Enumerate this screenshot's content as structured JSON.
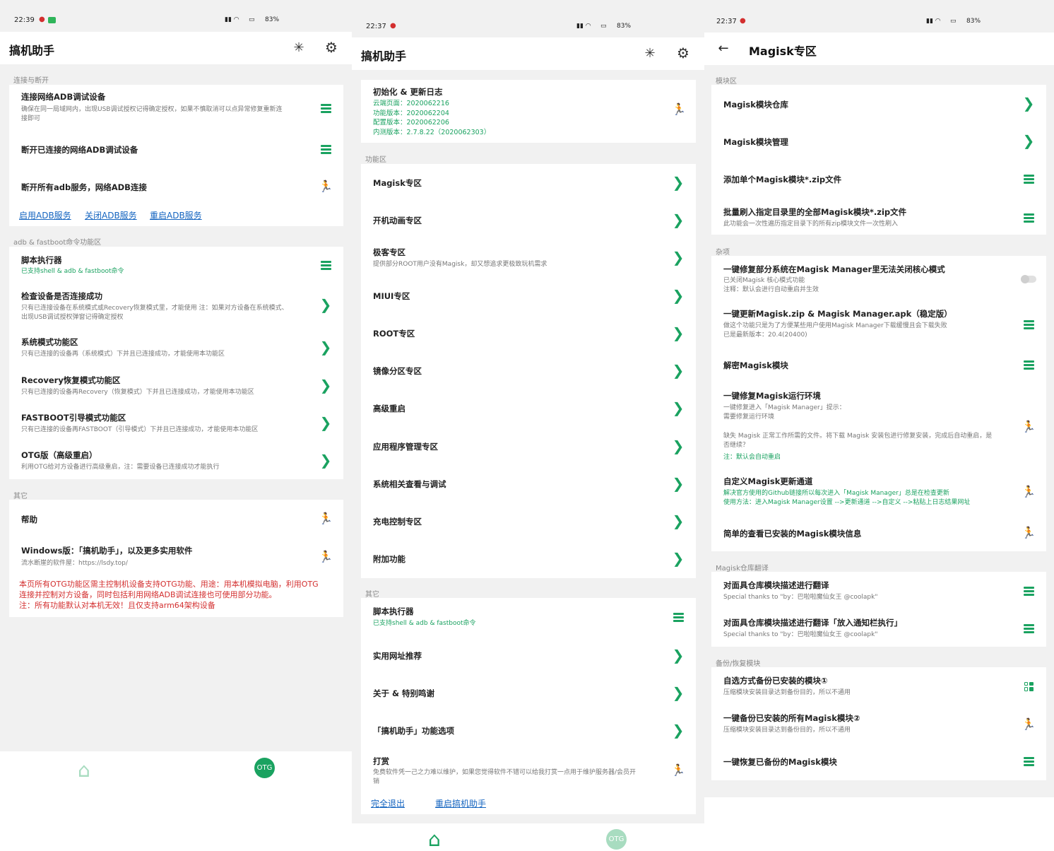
{
  "colors": {
    "accent": "#1aa260",
    "link": "#1565c0",
    "warning": "#d32f2f",
    "background": "#f1f1f1"
  },
  "screen1": {
    "status": {
      "time": "22:39",
      "battery": "83%"
    },
    "title": "搞机助手",
    "sections": [
      {
        "label": "连接与断开"
      },
      {
        "label": "adb & fastboot命令功能区"
      },
      {
        "label": "其它"
      }
    ],
    "items": [
      {
        "title": "连接网络ADB调试设备",
        "sub": "确保在同一局域网内，出现USB调试授权记得确定授权，如果不慎取消可以点异常修复重新连",
        "sub2": "接即可",
        "icon": "menu-icon"
      },
      {
        "title": "断开已连接的网络ADB调试设备",
        "icon": "menu-icon"
      },
      {
        "title": "断开所有adb服务，网络ADB连接",
        "icon": "run-icon"
      },
      {
        "title": "脚本执行器",
        "sub": "已支持shell & adb & fastboot命令",
        "icon": "menu-icon"
      },
      {
        "title": "检查设备是否连接成功",
        "sub": "只有已连接设备在系统模式或Recovery恢复模式里，才能使用 注：如果对方设备在系统模式、",
        "sub2": "出现USB调试授权弹窗记得确定授权",
        "icon": "chevron-right-icon"
      },
      {
        "title": "系统模式功能区",
        "sub": "只有已连接的设备再（系统模式）下并且已连接成功，才能使用本功能区",
        "icon": "chevron-right-icon"
      },
      {
        "title": "Recovery恢复模式功能区",
        "sub": "只有已连接的设备再Recovery（恢复模式）下并且已连接成功，才能使用本功能区",
        "icon": "chevron-right-icon"
      },
      {
        "title": "FASTBOOT引导模式功能区",
        "sub": "只有已连接的设备再FASTBOOT（引导模式）下并且已连接成功，才能使用本功能区",
        "icon": "chevron-right-icon"
      },
      {
        "title": "OTG版（高级重启）",
        "sub": "利用OTG给对方设备进行高级重启，注：需要设备已连接成功才能执行",
        "icon": "chevron-right-icon"
      },
      {
        "title": "帮助",
        "icon": "run-icon"
      },
      {
        "title": "Windows版：「搞机助手」，以及更多实用软件",
        "sub": "流水断崖的软件屋：https://lsdy.top/",
        "icon": "run-icon"
      }
    ],
    "links": [
      "启用ADB服务",
      "关闭ADB服务",
      "重启ADB服务"
    ],
    "warning": [
      "本页所有OTG功能区需主控制机设备支持OTG功能、用途：用本机模拟电脑，利用OTG",
      "连接并控制对方设备，同时包括利用网络ADB调试连接也可使用部分功能。",
      "注：所有功能默认对本机无效！且仅支持arm64架构设备"
    ],
    "otg": "OTG"
  },
  "screen2": {
    "status": {
      "time": "22:37",
      "battery": "83%"
    },
    "title": "搞机助手",
    "init": {
      "title": "初始化 & 更新日志",
      "lines": [
        "云端页面：2020062216",
        "功能版本：2020062204",
        "配置版本：2020062206",
        "内测版本：2.7.8.22（2020062303）"
      ]
    },
    "sections": [
      {
        "label": "功能区"
      },
      {
        "label": "其它"
      }
    ],
    "features": [
      {
        "title": "Magisk专区"
      },
      {
        "title": "开机动画专区"
      },
      {
        "title": "极客专区",
        "sub": "提供部分ROOT用户没有Magisk，却又想追求更极致玩机需求"
      },
      {
        "title": "MIUI专区"
      },
      {
        "title": "ROOT专区"
      },
      {
        "title": "镜像分区专区"
      },
      {
        "title": "高级重启"
      },
      {
        "title": "应用程序管理专区"
      },
      {
        "title": "系统相关查看与调试"
      },
      {
        "title": "充电控制专区"
      },
      {
        "title": "附加功能"
      }
    ],
    "others": [
      {
        "title": "脚本执行器",
        "sub": "已支持shell & adb & fastboot命令",
        "icon": "menu-icon"
      },
      {
        "title": "实用网址推荐",
        "icon": "chevron-right-icon"
      },
      {
        "title": "关于 & 特别鸣谢",
        "icon": "chevron-right-icon"
      },
      {
        "title": "「搞机助手」功能选项",
        "icon": "chevron-right-icon"
      },
      {
        "title": "打赏",
        "sub": "免费软件凭一己之力难以维护，如果您觉得软件不错可以给我打赏一点用于维护服务器/会员开",
        "sub2": "销",
        "icon": "run-icon"
      }
    ],
    "links": [
      "完全退出",
      "重启搞机助手"
    ],
    "otg": "OTG"
  },
  "screen3": {
    "status": {
      "time": "22:37",
      "battery": "83%"
    },
    "title": "Magisk专区",
    "sections": [
      {
        "label": "模块区"
      },
      {
        "label": "杂项"
      },
      {
        "label": "Magisk仓库翻译"
      },
      {
        "label": "备份/恢复模块"
      }
    ],
    "modules": [
      {
        "title": "Magisk模块仓库",
        "icon": "chevron-right-icon"
      },
      {
        "title": "Magisk模块管理",
        "icon": "chevron-right-icon"
      },
      {
        "title": "添加单个Magisk模块*.zip文件",
        "icon": "menu-icon"
      },
      {
        "title": "批量刷入指定目录里的全部Magisk模块*.zip文件",
        "sub": "此功能会一次性遍历指定目录下的所有zip模块文件一次性刷入",
        "icon": "menu-icon"
      }
    ],
    "misc": [
      {
        "title": "一键修复部分系统在Magisk Manager里无法关闭核心模式",
        "sub": "已关闭Magisk 核心模式功能",
        "sub2": "注释：默认会进行自动重启并生效",
        "icon": "toggle-icon"
      },
      {
        "title": "一键更新Magisk.zip & Magisk Manager.apk（稳定版）",
        "sub": "做这个功能只是为了方便某些用户使用Magisk Manager下载缓慢且会下载失败",
        "sub2": "已是最新版本：20.4(20400)",
        "icon": "menu-icon"
      },
      {
        "title": "解密Magisk模块",
        "icon": "menu-icon"
      },
      {
        "title": "一键修复Magisk运行环境",
        "sub": "一键修复进入「Magisk Manager」提示：",
        "sub2": "需要修复运行环境",
        "sub3": "缺失 Magisk 正常工作所需的文件。将下载 Magisk 安装包进行修复安装，完成后自动重启，是",
        "sub4": "否继续？",
        "sub5": "注：默认会自动重启",
        "icon": "run-icon"
      },
      {
        "title": "自定义Magisk更新通道",
        "sub": "解决官方使用的Github链接所以每次进入「Magisk Manager」总是在检查更新",
        "sub2": "使用方法：进入Magisk Manager设置 -->更新通道 -->自定义 -->粘贴上日志结果网址",
        "icon": "run-icon"
      },
      {
        "title": "简单的查看已安装的Magisk模块信息",
        "icon": "run-icon"
      }
    ],
    "translate": [
      {
        "title": "对面具仓库模块描述进行翻译",
        "sub": "Special thanks to \"by：巴啦啦魔仙女王 @coolapk\"",
        "icon": "menu-icon"
      },
      {
        "title": "对面具仓库模块描述进行翻译「放入通知栏执行」",
        "sub": "Special thanks to \"by：巴啦啦魔仙女王 @coolapk\"",
        "icon": "menu-icon"
      }
    ],
    "backup": [
      {
        "title": "自选方式备份已安装的模块①",
        "sub": "压缩模块安装目录达到备份目的，所以不通用",
        "icon": "grid-icon"
      },
      {
        "title": "一键备份已安装的所有Magisk模块②",
        "sub": "压缩模块安装目录达到备份目的，所以不通用",
        "icon": "run-icon"
      },
      {
        "title": "一键恢复已备份的Magisk模块",
        "icon": "menu-icon"
      }
    ]
  }
}
